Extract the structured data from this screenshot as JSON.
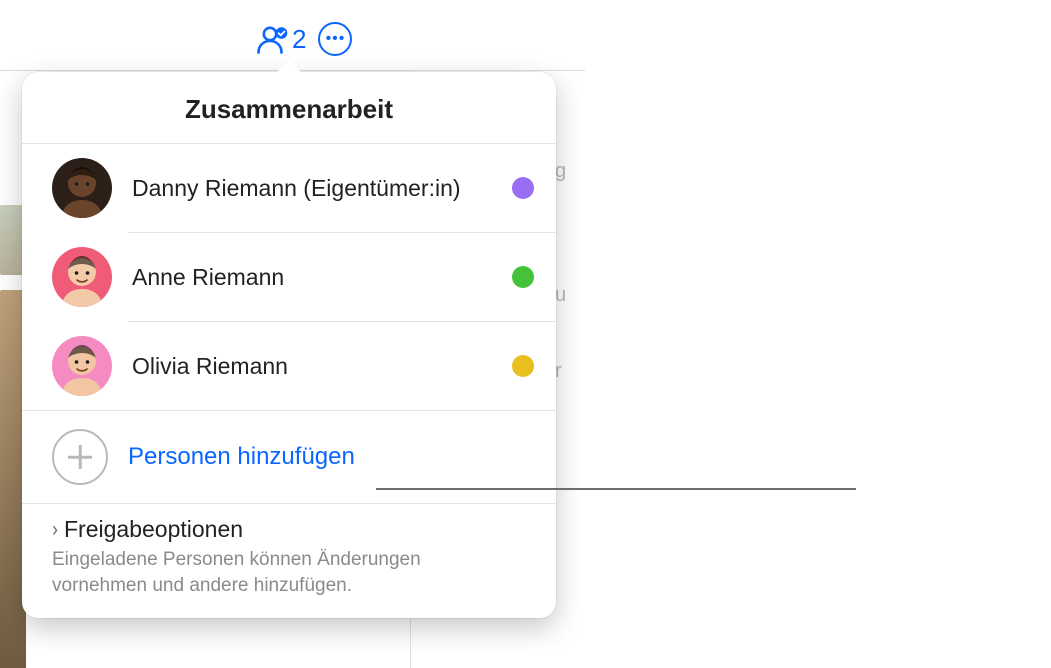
{
  "toolbar": {
    "collaborators_count": "2"
  },
  "popover": {
    "title": "Zusammenarbeit",
    "participants": [
      {
        "name": "Danny Riemann (Eigentümer:in)",
        "dot_color": "#9a6ef2",
        "avatar_bg": "#2b1f18",
        "avatar_face": "#6a442a"
      },
      {
        "name": "Anne Riemann",
        "dot_color": "#45c23a",
        "avatar_bg": "#f05c78",
        "avatar_face": "#f2caa7"
      },
      {
        "name": "Olivia Riemann",
        "dot_color": "#e9be1f",
        "avatar_bg": "#f58bc0",
        "avatar_face": "#f2c6a3"
      }
    ],
    "add_label": "Personen hinzufügen",
    "options_title": "Freigabeoptionen",
    "options_subtitle": "Eingeladene Personen können Änderungen vornehmen und andere hinzufügen."
  }
}
